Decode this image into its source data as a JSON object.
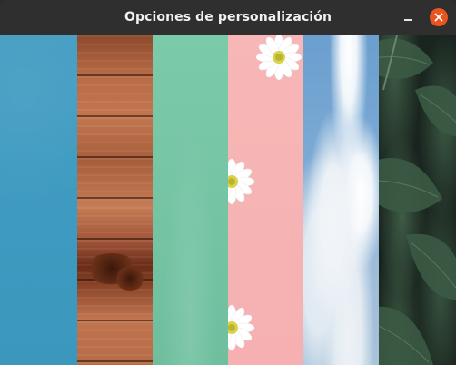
{
  "window": {
    "title": "Opciones de personalización",
    "controls": {
      "minimize_icon": "minimize-icon",
      "close_icon": "close-icon"
    },
    "close_color": "#e9541f",
    "titlebar_color": "#2f2f2f"
  },
  "wallpapers": [
    {
      "name": "blue-texture",
      "color": "#3f9bc1"
    },
    {
      "name": "wood-planks",
      "color": "#b86a45"
    },
    {
      "name": "mint-texture",
      "color": "#76c5a5"
    },
    {
      "name": "pink-daisies",
      "color": "#f6b0b1"
    },
    {
      "name": "sky-clouds",
      "color": "#7aa9d4"
    },
    {
      "name": "dark-leaves",
      "color": "#2d4235"
    }
  ]
}
